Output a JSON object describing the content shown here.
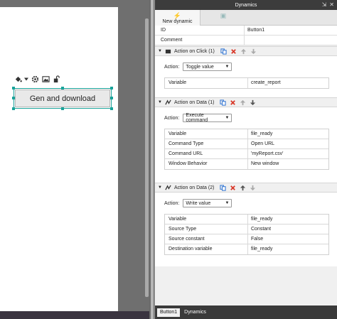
{
  "canvas": {
    "button_label": "Gen and download"
  },
  "panel": {
    "title": "Dynamics",
    "tabs": [
      {
        "label": "New dynamic"
      },
      {
        "label": ""
      }
    ],
    "props": [
      {
        "key": "ID",
        "value": "Button1"
      },
      {
        "key": "Comment",
        "value": ""
      }
    ],
    "sections": [
      {
        "title": "Action on Click (1)",
        "action_label": "Action:",
        "action_value": "Toggle value",
        "rows": [
          {
            "key": "Variable",
            "value": "create_report"
          }
        ]
      },
      {
        "title": "Action on Data (1)",
        "action_label": "Action:",
        "action_value": "Execute command",
        "rows": [
          {
            "key": "Variable",
            "value": "file_ready"
          },
          {
            "key": "Command Type",
            "value": "Open URL"
          },
          {
            "key": "Command URL",
            "value": "'myReport.csv'"
          },
          {
            "key": "Window Behavior",
            "value": "New window"
          }
        ]
      },
      {
        "title": "Action on Data (2)",
        "action_label": "Action:",
        "action_value": "Write value",
        "rows": [
          {
            "key": "Variable",
            "value": "file_ready"
          },
          {
            "key": "Source Type",
            "value": "Constant"
          },
          {
            "key": "Source constant",
            "value": "False"
          },
          {
            "key": "Destination variable",
            "value": "file_ready"
          }
        ]
      }
    ],
    "bottom_tabs": [
      {
        "label": "Button1"
      },
      {
        "label": "Dynamics"
      }
    ]
  },
  "icons": {
    "palette": "paint-bucket-icon",
    "gear": "gear-icon",
    "image": "image-icon",
    "lock": "lock-icon",
    "copy": "copy-icon",
    "delete": "delete-icon",
    "up": "arrow-up-icon",
    "down": "arrow-down-icon"
  },
  "colors": {
    "selection": "#1aa39a",
    "delete": "#d93a2b",
    "header": "#3c3c3c"
  }
}
